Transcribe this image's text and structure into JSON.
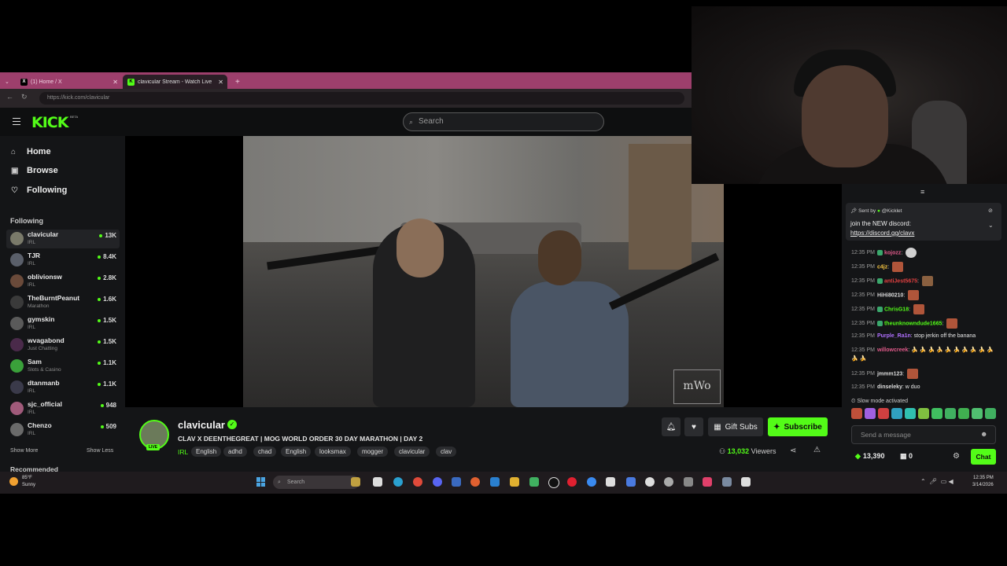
{
  "browser": {
    "tabs": [
      {
        "title": "(1) Home / X",
        "icon": "x-logo-icon"
      },
      {
        "title": "clavicular Stream - Watch Live",
        "icon": "kick-logo-icon"
      }
    ],
    "new_tab": "+",
    "url": "https://kick.com/clavicular"
  },
  "kick": {
    "logo": "KICK",
    "beta": "BETA",
    "search_placeholder": "Search",
    "nav": [
      {
        "label": "Home",
        "icon": "home-icon"
      },
      {
        "label": "Browse",
        "icon": "browse-icon"
      },
      {
        "label": "Following",
        "icon": "heart-icon"
      }
    ],
    "following_heading": "Following",
    "channels": [
      {
        "name": "clavicular",
        "category": "IRL",
        "viewers": "13K",
        "color": "#7a7a6a"
      },
      {
        "name": "TJR",
        "category": "IRL",
        "viewers": "8.4K",
        "color": "#5a5f6a"
      },
      {
        "name": "oblivionsw",
        "category": "IRL",
        "viewers": "2.8K",
        "color": "#6a4a3a"
      },
      {
        "name": "TheBurntPeanut",
        "category": "Marathon",
        "viewers": "1.6K",
        "color": "#3a3a3a"
      },
      {
        "name": "gymskin",
        "category": "IRL",
        "viewers": "1.5K",
        "color": "#5a5a5a"
      },
      {
        "name": "wvagabond",
        "category": "Just Chatting",
        "viewers": "1.5K",
        "color": "#4a2a4a"
      },
      {
        "name": "Sam",
        "category": "Slots & Casino",
        "viewers": "1.1K",
        "color": "#3aa03a"
      },
      {
        "name": "dtanmanb",
        "category": "IRL",
        "viewers": "1.1K",
        "color": "#3a3a4a"
      },
      {
        "name": "sjc_official",
        "category": "IRL",
        "viewers": "948",
        "color": "#a05a7a"
      },
      {
        "name": "Chenzo",
        "category": "IRL",
        "viewers": "509",
        "color": "#6a6a6a"
      }
    ],
    "show_more": "Show More",
    "show_less": "Show Less",
    "recommended": "Recommended"
  },
  "stream": {
    "watermark": "mWo",
    "streamer": "clavicular",
    "live_badge": "LIVE",
    "title": "CLAV X DEENTHEGREAT | MOG WORLD ORDER 30 DAY MARATHON | DAY 2",
    "category": "IRL",
    "tags": [
      "English",
      "adhd",
      "chad",
      "English",
      "looksmax",
      "mogger",
      "clavicular",
      "clav"
    ],
    "gift_subs": "Gift Subs",
    "subscribe": "Subscribe",
    "viewers_count": "13,032",
    "viewers_label": "Viewers"
  },
  "chat": {
    "pinned": {
      "sent_by": "Sent by",
      "sender": "@Kicklet",
      "message": "join the NEW discord:",
      "link": "https://discord.gg/clavx"
    },
    "messages": [
      {
        "time": "12:35 PM",
        "user": "kojozz",
        "color": "#e05a8a",
        "text": "",
        "emotes": 1
      },
      {
        "time": "12:35 PM",
        "user": "c4jz",
        "color": "#f0c040",
        "text": "",
        "emotes": 1
      },
      {
        "time": "12:35 PM",
        "user": "antiJest5675",
        "color": "#e04040",
        "text": "",
        "emotes": 1
      },
      {
        "time": "12:35 PM",
        "user": "HiHi80210",
        "color": "#dcdcdc",
        "text": "",
        "emotes": 1
      },
      {
        "time": "12:35 PM",
        "user": "ChrisG18",
        "color": "#53fc18",
        "text": "",
        "emotes": 1
      },
      {
        "time": "12:35 PM",
        "user": "theunknowndude1665",
        "color": "#53fc18",
        "text": "",
        "emotes": 1
      },
      {
        "time": "12:35 PM",
        "user": "Purple_Ra1n",
        "color": "#b070ff",
        "text": "stop jerkin off the banana",
        "emotes": 0
      },
      {
        "time": "12:35 PM",
        "user": "willowcreek",
        "color": "#e05a8a",
        "text": "🍌 🍌 🍌 🍌 🍌 🍌 🍌 🍌 🍌 🍌 🍌 🍌",
        "emotes": 0
      },
      {
        "time": "12:35 PM",
        "user": "jmmm123",
        "color": "#dcdcdc",
        "text": "",
        "emotes": 1
      },
      {
        "time": "12:35 PM",
        "user": "dinseleky",
        "color": "#dcdcdc",
        "text": "w duo",
        "emotes": 0
      }
    ],
    "slow_mode": "Slow mode activated",
    "input_placeholder": "Send a message",
    "points": "13,390",
    "gifts": "0",
    "chat_button": "Chat"
  },
  "taskbar": {
    "weather_temp": "85°F",
    "weather_desc": "Sunny",
    "search_placeholder": "Search",
    "time": "12:35 PM",
    "date": "3/14/2026"
  }
}
